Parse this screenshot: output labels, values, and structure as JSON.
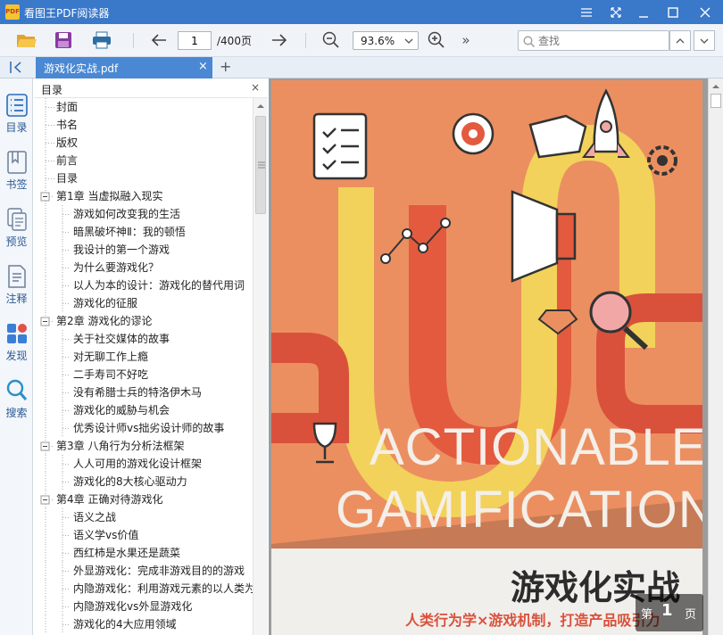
{
  "app": {
    "title": "看图王PDF阅读器",
    "logo_text": "PDF"
  },
  "toolbar": {
    "current_page": "1",
    "total_pages": "/400页",
    "zoom": "93.6%",
    "search_placeholder": "查找",
    "more": "»"
  },
  "tab": {
    "label": "游戏化实战.pdf",
    "close": "×",
    "new": "+"
  },
  "sidebar": {
    "items": [
      {
        "label": "目录",
        "icon": "list-icon"
      },
      {
        "label": "书签",
        "icon": "bookmark-icon"
      },
      {
        "label": "预览",
        "icon": "thumbnails-icon"
      },
      {
        "label": "注释",
        "icon": "annotation-icon"
      },
      {
        "label": "发现",
        "icon": "discover-icon"
      },
      {
        "label": "搜索",
        "icon": "search-icon"
      }
    ]
  },
  "toc": {
    "title": "目录",
    "close": "×",
    "items": [
      {
        "label": "封面",
        "level": 0,
        "expandable": false
      },
      {
        "label": "书名",
        "level": 0,
        "expandable": false
      },
      {
        "label": "版权",
        "level": 0,
        "expandable": false
      },
      {
        "label": "前言",
        "level": 0,
        "expandable": false
      },
      {
        "label": "目录",
        "level": 0,
        "expandable": false
      },
      {
        "label": "第1章 当虚拟融入现实",
        "level": 0,
        "expandable": true
      },
      {
        "label": "游戏如何改变我的生活",
        "level": 1,
        "expandable": false
      },
      {
        "label": "暗黑破坏神Ⅱ：我的顿悟",
        "level": 1,
        "expandable": false
      },
      {
        "label": "我设计的第一个游戏",
        "level": 1,
        "expandable": false
      },
      {
        "label": "为什么要游戏化？",
        "level": 1,
        "expandable": false
      },
      {
        "label": "以人为本的设计：游戏化的替代用词",
        "level": 1,
        "expandable": false
      },
      {
        "label": "游戏化的征服",
        "level": 1,
        "expandable": false
      },
      {
        "label": "第2章 游戏化的谬论",
        "level": 0,
        "expandable": true
      },
      {
        "label": "关于社交媒体的故事",
        "level": 1,
        "expandable": false
      },
      {
        "label": "对无聊工作上瘾",
        "level": 1,
        "expandable": false
      },
      {
        "label": "二手寿司不好吃",
        "level": 1,
        "expandable": false
      },
      {
        "label": "没有希腊士兵的特洛伊木马",
        "level": 1,
        "expandable": false
      },
      {
        "label": "游戏化的威胁与机会",
        "level": 1,
        "expandable": false
      },
      {
        "label": "优秀设计师vs拙劣设计师的故事",
        "level": 1,
        "expandable": false
      },
      {
        "label": "第3章 八角行为分析法框架",
        "level": 0,
        "expandable": true
      },
      {
        "label": "人人可用的游戏化设计框架",
        "level": 1,
        "expandable": false
      },
      {
        "label": "游戏化的8大核心驱动力",
        "level": 1,
        "expandable": false
      },
      {
        "label": "第4章 正确对待游戏化",
        "level": 0,
        "expandable": true
      },
      {
        "label": "语义之战",
        "level": 1,
        "expandable": false
      },
      {
        "label": "语义学vs价值",
        "level": 1,
        "expandable": false
      },
      {
        "label": "西红柿是水果还是蔬菜",
        "level": 1,
        "expandable": false
      },
      {
        "label": "外显游戏化：完成非游戏目的的游戏",
        "level": 1,
        "expandable": false
      },
      {
        "label": "内隐游戏化：利用游戏元素的以人类为",
        "level": 1,
        "expandable": false
      },
      {
        "label": "内隐游戏化vs外显游戏化",
        "level": 1,
        "expandable": false
      },
      {
        "label": "游戏化的4大应用领域",
        "level": 1,
        "expandable": false
      }
    ]
  },
  "page": {
    "cover_title_line1": "ACTIONABLE",
    "cover_title_line2": "GAMIFICATION",
    "cover_cn_title": "游戏化实战",
    "cover_cn_subtitle": "人类行为学×游戏机制，打造产品吸引力"
  },
  "page_indicator": {
    "prefix": "第",
    "number": "1",
    "suffix": "页"
  },
  "colors": {
    "titlebar": "#3a78c9",
    "accent": "#4a88d4",
    "cover_bg": "#eb8f61",
    "cover_red": "#e35a3f",
    "cover_yellow": "#f2d25a"
  }
}
